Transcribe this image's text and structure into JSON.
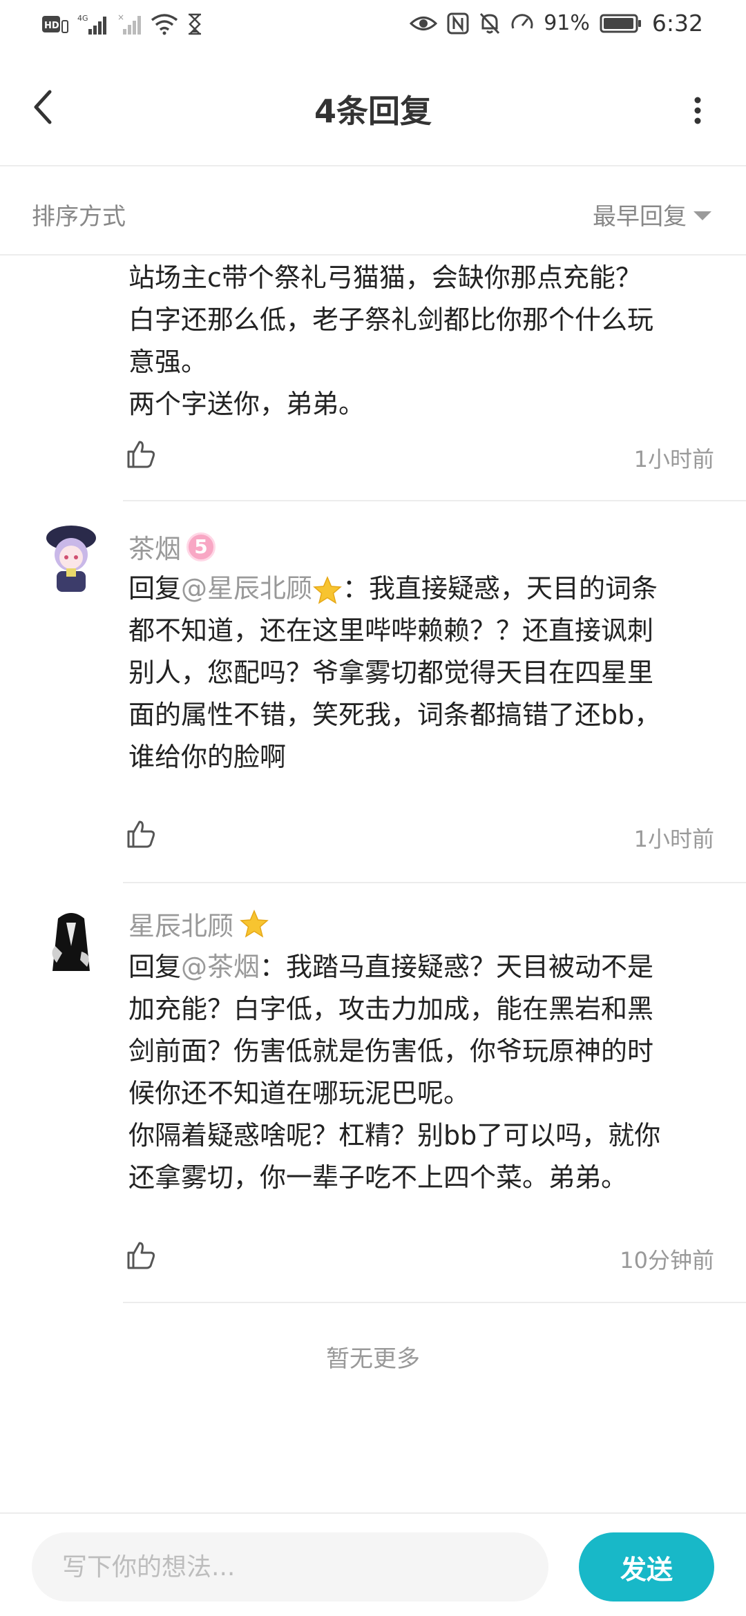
{
  "status_bar": {
    "time": "6:32",
    "battery_pct": "91%",
    "left_icons": [
      "hd-icon",
      "4g-signal-icon",
      "signal-icon",
      "wifi-icon",
      "hourglass-icon"
    ],
    "right_icons": [
      "eye-icon",
      "nfc-icon",
      "mute-icon",
      "speed-icon",
      "battery-icon"
    ]
  },
  "header": {
    "title": "4条回复"
  },
  "sort": {
    "label": "排序方式",
    "selected": "最早回复"
  },
  "comments": [
    {
      "continued": true,
      "lines": [
        "站场主c带个祭礼弓猫猫，会缺你那点充能？",
        "白字还那么低，老子祭礼剑都比你那个什么玩",
        "意强。",
        "两个字送你，弟弟。"
      ],
      "time": "1小时前"
    },
    {
      "username": "茶烟",
      "level": "5",
      "reply_prefix": "回复",
      "mention": "@星辰北顾",
      "lines_first_suffix": "：我直接疑惑，天目的词条",
      "lines": [
        "都不知道，还在这里哔哔赖赖？？还直接讽刺",
        "别人，您配吗？爷拿雾切都觉得天目在四星里",
        "面的属性不错，笑死我，词条都搞错了还bb，",
        "谁给你的脸啊"
      ],
      "time": "1小时前"
    },
    {
      "username": "星辰北顾",
      "reply_prefix": "回复",
      "mention": "@茶烟",
      "lines_first_suffix": "：我踏马直接疑惑？天目被动不是",
      "lines": [
        "加充能？白字低，攻击力加成，能在黑岩和黑",
        "剑前面？伤害低就是伤害低，你爷玩原神的时",
        "候你还不知道在哪玩泥巴呢。",
        "你隔着疑惑啥呢？杠精？别bb了可以吗，就你",
        "还拿雾切，你一辈子吃不上四个菜。弟弟。"
      ],
      "time": "10分钟前"
    }
  ],
  "no_more": "暂无更多",
  "input": {
    "placeholder": "写下你的想法...",
    "send_label": "发送"
  },
  "colors": {
    "accent": "#18b8c8",
    "muted_text": "#999999",
    "divider": "#ececec"
  }
}
